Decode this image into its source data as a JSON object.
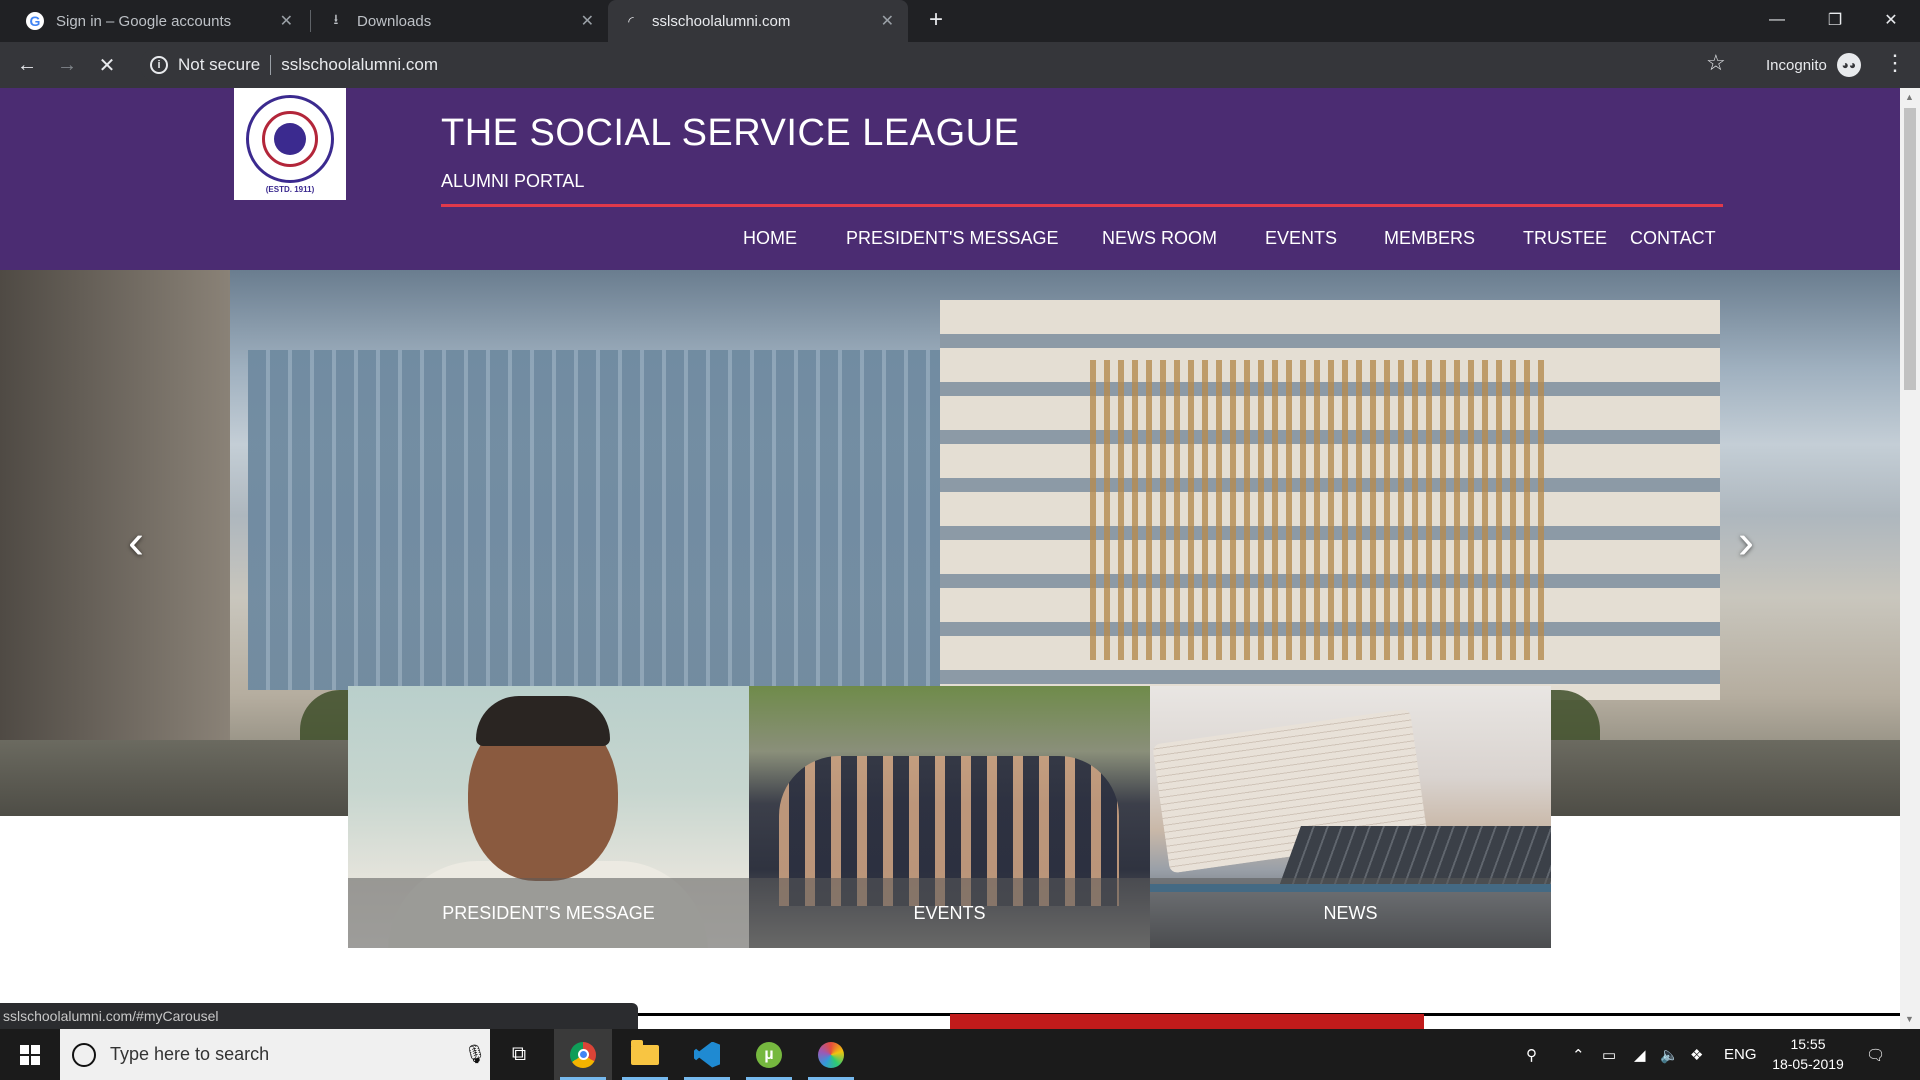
{
  "browser": {
    "tabs": [
      {
        "title": "Sign in – Google accounts",
        "icon": "google-icon"
      },
      {
        "title": "Downloads",
        "icon": "download-icon"
      },
      {
        "title": "sslschoolalumni.com",
        "icon": "loading-icon"
      }
    ],
    "security_label": "Not secure",
    "url": "sslschoolalumni.com",
    "profile_label": "Incognito"
  },
  "site": {
    "logo_est": "(ESTD. 1911)",
    "title": "THE SOCIAL SERVICE LEAGUE",
    "subtitle": "ALUMNI PORTAL",
    "nav": [
      "HOME",
      "PRESIDENT'S MESSAGE",
      "NEWS ROOM",
      "EVENTS",
      "MEMBERS",
      "TRUSTEE",
      "CONTACT"
    ],
    "carousel": {
      "prev": "‹",
      "next": "›"
    },
    "cards": [
      {
        "caption": "PRESIDENT'S MESSAGE"
      },
      {
        "caption": "EVENTS"
      },
      {
        "caption": "NEWS"
      }
    ]
  },
  "status_url": "sslschoolalumni.com/#myCarousel",
  "taskbar": {
    "search_placeholder": "Type here to search",
    "language": "ENG",
    "time": "15:55",
    "date": "18-05-2019"
  },
  "colors": {
    "header_bg": "#4b2c72",
    "accent_red": "#e0394b",
    "bottom_red": "#c11b1b"
  }
}
